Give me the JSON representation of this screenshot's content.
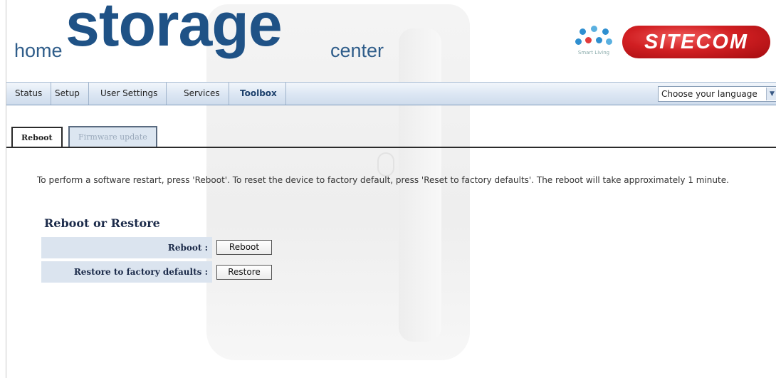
{
  "brand": {
    "home": "home",
    "storage": "storage",
    "center": "center",
    "smart_living": "Smart Living",
    "sitecom": "SITECOM"
  },
  "nav": {
    "items": [
      "Status",
      "Setup",
      "User Settings",
      "Services",
      "Toolbox"
    ],
    "active": "Toolbox",
    "language": "Choose your language"
  },
  "tabs": [
    "Reboot",
    "Firmware update"
  ],
  "description": "To perform a software restart, press 'Reboot'. To reset the device to factory default, press 'Reset to factory defaults'. The reboot will take approximately 1 minute.",
  "section_title": "Reboot or Restore",
  "rows": [
    {
      "label": "Reboot :",
      "button": "Reboot"
    },
    {
      "label": "Restore to factory defaults :",
      "button": "Restore"
    }
  ],
  "colors": {
    "brand_blue": "#1f5286",
    "sitecom_red": "#d11f22",
    "nav_bg": "#dbe6f3",
    "row_bg": "#dbe4ef"
  }
}
